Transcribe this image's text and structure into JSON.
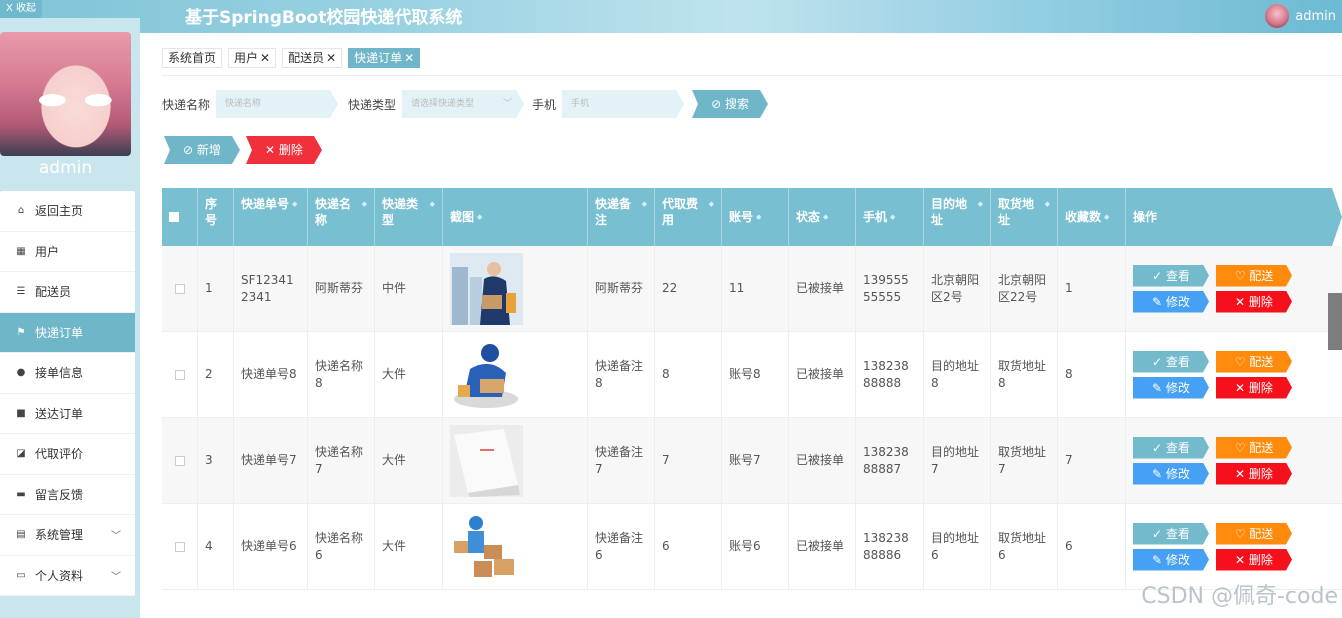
{
  "app": {
    "title": "基于SpringBoot校园快递代取系统",
    "user": "admin",
    "collapse_label": "X 收起"
  },
  "sidebar": {
    "admin_name": "admin",
    "items": [
      {
        "label": "返回主页",
        "icon": "home-icon"
      },
      {
        "label": "用户",
        "icon": "grid-icon"
      },
      {
        "label": "配送员",
        "icon": "list-icon"
      },
      {
        "label": "快递订单",
        "icon": "flag-icon",
        "active": true
      },
      {
        "label": "接单信息",
        "icon": "person-icon"
      },
      {
        "label": "送达订单",
        "icon": "box-icon"
      },
      {
        "label": "代取评价",
        "icon": "chart-icon"
      },
      {
        "label": "留言反馈",
        "icon": "monitor-icon"
      },
      {
        "label": "系统管理",
        "icon": "doc-icon"
      },
      {
        "label": "个人资料",
        "icon": "card-icon"
      }
    ]
  },
  "tags": [
    "系统首页",
    "用户",
    "配送员",
    "快递订单"
  ],
  "search": {
    "name_label": "快递名称",
    "name_placeholder": "快递名称",
    "type_label": "快递类型",
    "type_placeholder": "请选择快递类型",
    "phone_label": "手机",
    "phone_placeholder": "手机",
    "search_btn": "搜索"
  },
  "actions": {
    "add": "新增",
    "delete": "删除"
  },
  "table": {
    "headers": [
      "序号",
      "快递单号",
      "快递名称",
      "快递类型",
      "截图",
      "快递备注",
      "代取费用",
      "账号",
      "状态",
      "手机",
      "目的地址",
      "取货地址",
      "收藏数",
      "操作"
    ],
    "rows": [
      {
        "no": "1",
        "number": "SF123412341",
        "name": "阿斯蒂芬",
        "type": "中件",
        "remark": "阿斯蒂芬",
        "fee": "22",
        "account": "11",
        "status": "已被接单",
        "phone": "13955555555",
        "dest": "北京朝阳区2号",
        "pickup": "北京朝阳区22号",
        "fav": "1",
        "img": "courier-photo"
      },
      {
        "no": "2",
        "number": "快递单号8",
        "name": "快递名称8",
        "type": "大件",
        "remark": "快递备注8",
        "fee": "8",
        "account": "账号8",
        "status": "已被接单",
        "phone": "13823888888",
        "dest": "目的地址8",
        "pickup": "取货地址8",
        "fav": "8",
        "img": "packing-illustration"
      },
      {
        "no": "3",
        "number": "快递单号7",
        "name": "快递名称7",
        "type": "大件",
        "remark": "快递备注7",
        "fee": "7",
        "account": "账号7",
        "status": "已被接单",
        "phone": "13823888887",
        "dest": "目的地址7",
        "pickup": "取货地址7",
        "fav": "7",
        "img": "envelope-photo"
      },
      {
        "no": "4",
        "number": "快递单号6",
        "name": "快递名称6",
        "type": "大件",
        "remark": "快递备注6",
        "fee": "6",
        "account": "账号6",
        "status": "已被接单",
        "phone": "13823888886",
        "dest": "目的地址6",
        "pickup": "取货地址6",
        "fav": "6",
        "img": "boxes-illustration"
      }
    ],
    "ops": {
      "view": "查看",
      "send": "配送",
      "edit": "修改",
      "del": "删除"
    }
  },
  "watermark": "CSDN @佩奇-code"
}
